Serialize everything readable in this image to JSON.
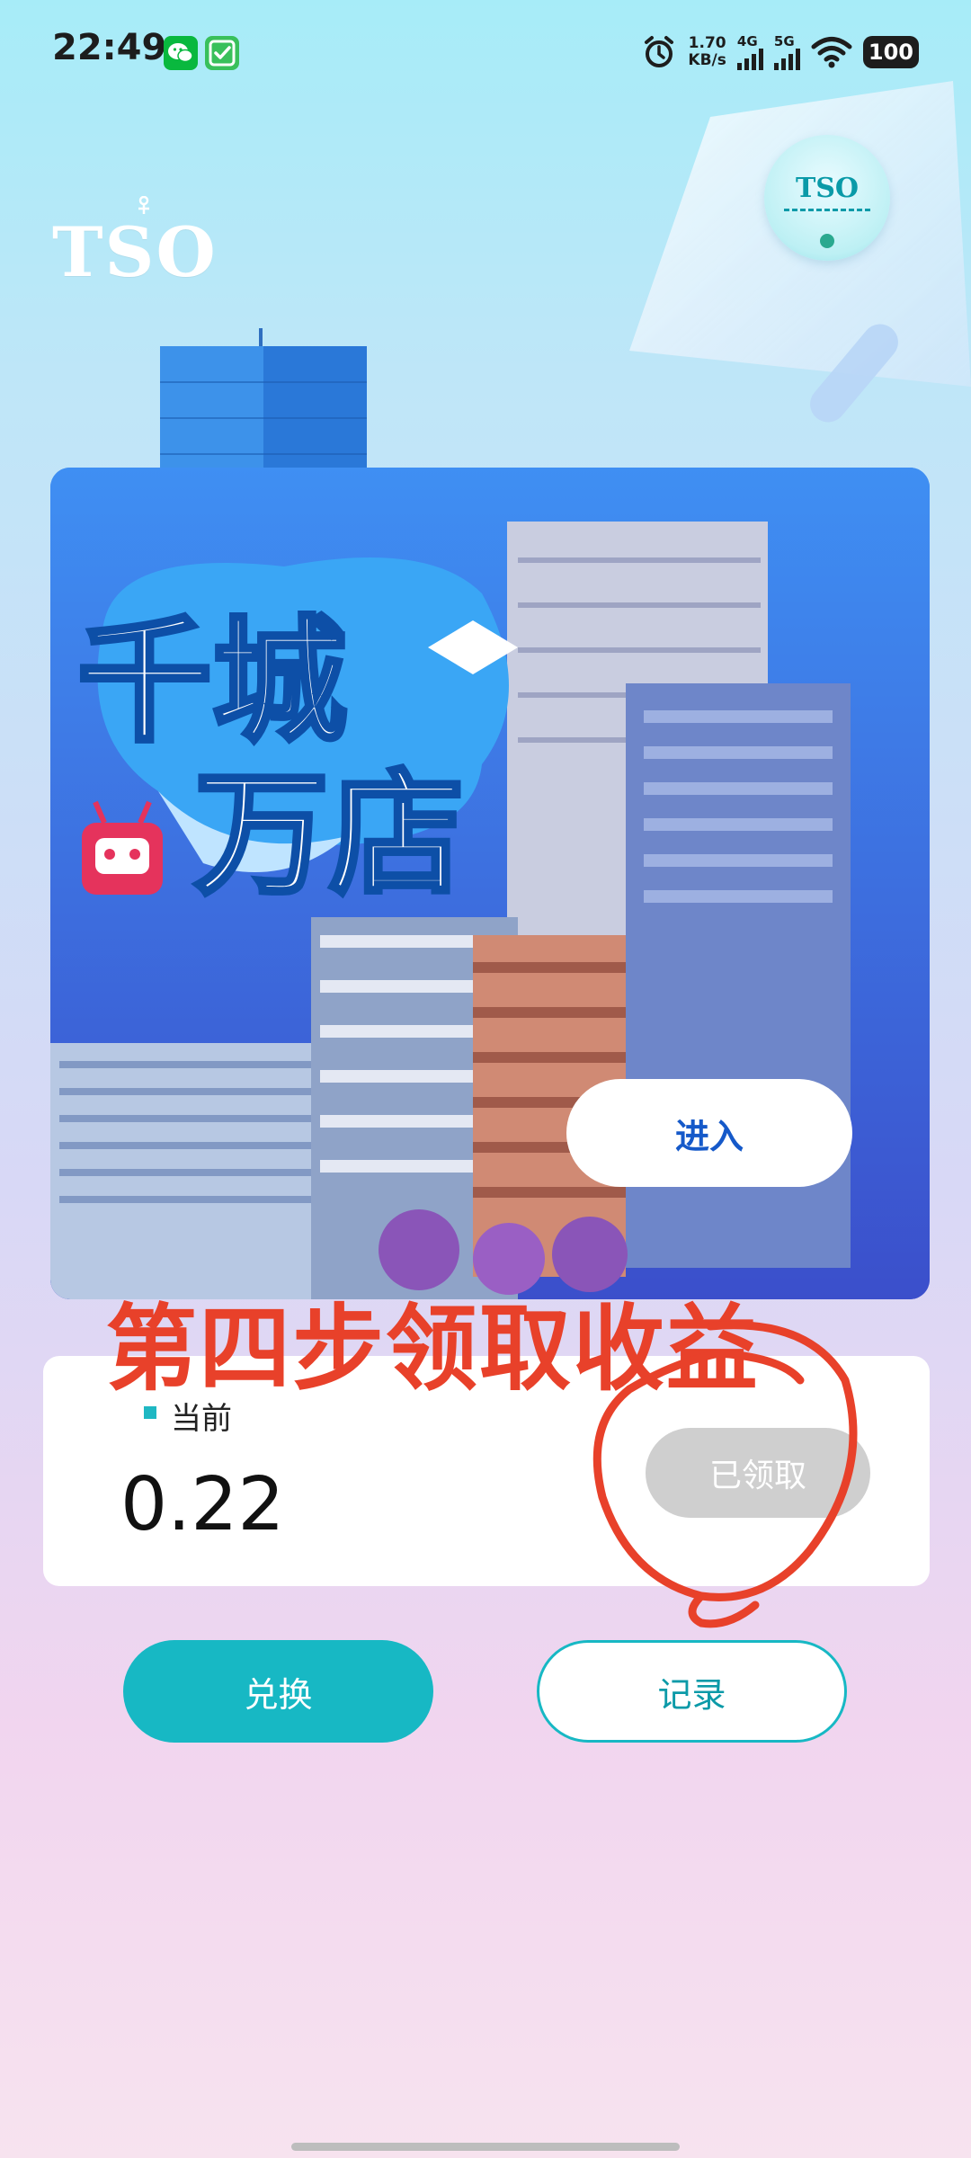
{
  "status_bar": {
    "time": "22:49",
    "net_speed_value": "1.70",
    "net_speed_unit": "KB/s",
    "signal_1_label": "4G",
    "signal_2_label": "5G",
    "battery": "100",
    "icons": [
      "wechat-icon",
      "check-icon",
      "alarm-icon",
      "wifi-icon"
    ]
  },
  "brand": {
    "logo": "TSO",
    "avatar_text": "TSO"
  },
  "hero": {
    "title_line1": "千城",
    "title_line2": "万店",
    "enter_label": "进入"
  },
  "annotation": {
    "text": "第四步领取收益",
    "color": "#e8412a"
  },
  "earnings": {
    "current_label": "当前",
    "current_value": "0.22",
    "claimed_label": "已领取"
  },
  "actions": {
    "exchange_label": "兑换",
    "record_label": "记录"
  },
  "colors": {
    "accent": "#17b8c4",
    "enter_text": "#1559c9"
  }
}
